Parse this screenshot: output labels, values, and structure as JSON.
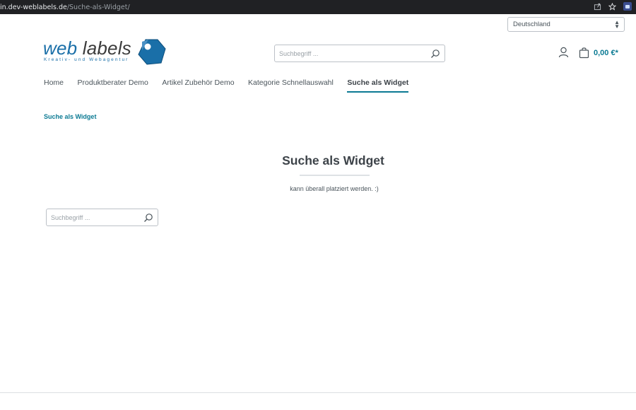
{
  "browser": {
    "url_host": "in.dev-weblabels.de",
    "url_path": "/Suche-als-Widget/"
  },
  "country_select": {
    "selected": "Deutschland"
  },
  "logo": {
    "word1": "web",
    "word2": "labels",
    "tagline": "Kreativ- und Webagentur"
  },
  "header_search": {
    "placeholder": "Suchbegriff ..."
  },
  "cart": {
    "total": "0,00 €*"
  },
  "nav": {
    "items": [
      {
        "label": "Home",
        "active": false
      },
      {
        "label": "Produktberater Demo",
        "active": false
      },
      {
        "label": "Artikel Zubehör Demo",
        "active": false
      },
      {
        "label": "Kategorie Schnellauswahl",
        "active": false
      },
      {
        "label": "Suche als Widget",
        "active": true
      }
    ]
  },
  "breadcrumb": {
    "current": "Suche als Widget"
  },
  "content": {
    "title": "Suche als Widget",
    "subtitle": "kann überall platziert werden.  :)"
  },
  "widget_search": {
    "placeholder": "Suchbegriff ..."
  },
  "colors": {
    "accent": "#0b7a93",
    "brand_blue": "#1a6fa8",
    "text": "#4a545b",
    "border": "#bcc1c7"
  },
  "icons": {
    "search": "search-icon",
    "account": "user-icon",
    "cart": "shopping-bag-icon",
    "share": "share-icon",
    "bookmark": "star-icon"
  }
}
